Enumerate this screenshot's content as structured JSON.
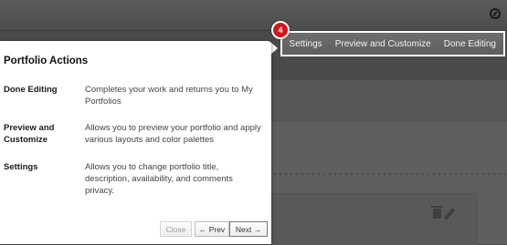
{
  "step": {
    "number": "4"
  },
  "toolbar": {
    "items": [
      "Settings",
      "Preview and Customize",
      "Done Editing"
    ]
  },
  "panel": {
    "title": "Portfolio Actions",
    "rows": [
      {
        "term": "Done Editing",
        "description": "Completes your work and returns you to My Portfolios"
      },
      {
        "term": "Preview and Customize",
        "description": "Allows you to preview your portfolio and apply various layouts and color palettes"
      },
      {
        "term": "Settings",
        "description": "Allows you to change portfolio title, description, availability, and comments privacy."
      }
    ],
    "buttons": {
      "close": "Close",
      "prev": "← Prev",
      "next": "Next →"
    }
  },
  "colors": {
    "overlay": "#4a4a4a",
    "badge": "#d7141a",
    "panel": "#ffffff"
  },
  "icons": [
    "compass-icon",
    "trash-icon",
    "pencil-icon"
  ]
}
